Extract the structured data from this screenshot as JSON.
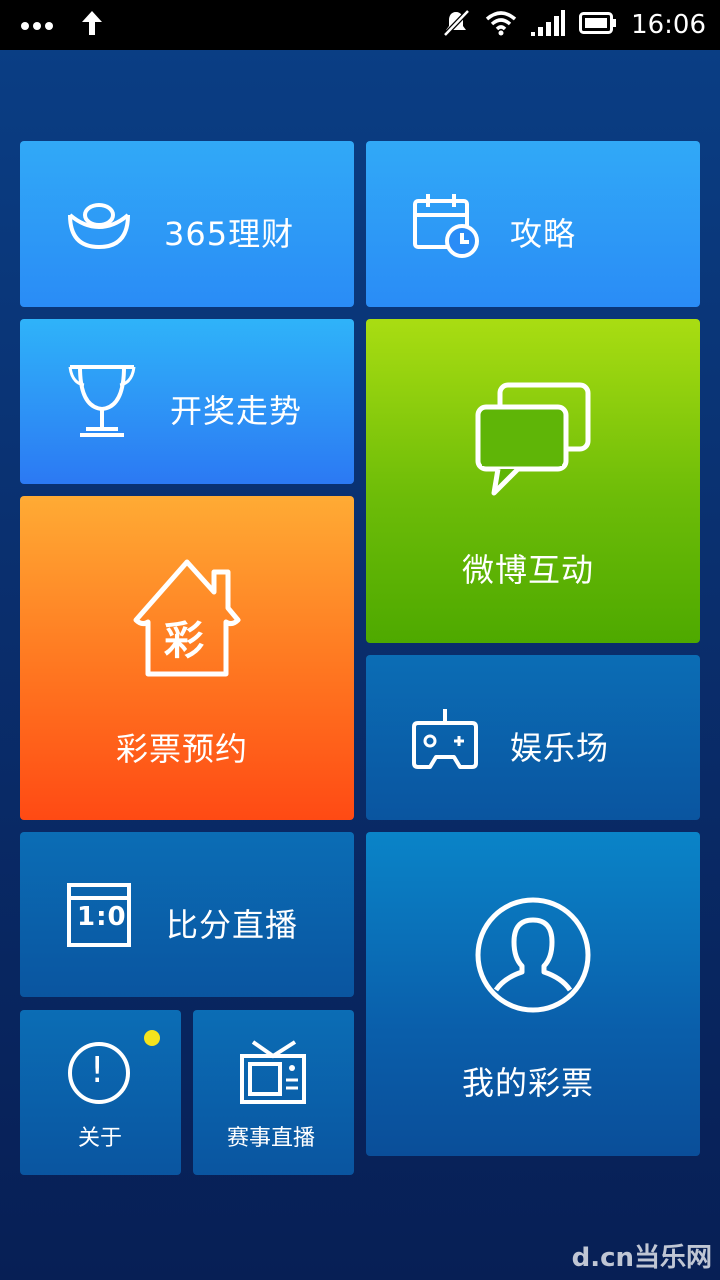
{
  "status_bar": {
    "time": "16:06",
    "icons": [
      "more-dots-icon",
      "upload-arrow-icon",
      "mute-icon",
      "wifi-icon",
      "signal-icon",
      "battery-icon"
    ]
  },
  "tiles": {
    "licai": {
      "label": "365理财",
      "icon": "ingot-icon"
    },
    "gonglue": {
      "label": "攻略",
      "icon": "calendar-clock-icon"
    },
    "kaijiang": {
      "label": "开奖走势",
      "icon": "trophy-icon"
    },
    "weibo": {
      "label": "微博互动",
      "icon": "chat-bubbles-icon"
    },
    "caipiao_yuyue": {
      "label": "彩票预约",
      "icon": "house-cai-icon",
      "icon_char": "彩"
    },
    "yulechang": {
      "label": "娱乐场",
      "icon": "gamepad-icon"
    },
    "bifen": {
      "label": "比分直播",
      "icon": "scoreboard-icon",
      "icon_text": "1:0"
    },
    "wode": {
      "label": "我的彩票",
      "icon": "user-avatar-icon"
    },
    "guanyu": {
      "label": "关于",
      "icon": "exclamation-circle-icon",
      "icon_char": "!"
    },
    "saishi": {
      "label": "赛事直播",
      "icon": "tv-icon"
    }
  },
  "watermark": "d.cn当乐网",
  "colors": {
    "background": "#0a2f6e",
    "tile_blue": "#2a8cf6",
    "tile_orange": "#ff7520",
    "tile_green": "#6dbc08",
    "tile_navy": "#0a55a0",
    "badge": "#f4e31c"
  }
}
